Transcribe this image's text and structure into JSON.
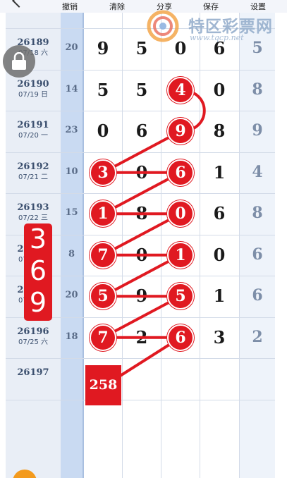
{
  "toolbar": {
    "undo": "撤销",
    "clear": "清除",
    "share": "分享",
    "save": "保存",
    "settings": "设置"
  },
  "watermark": {
    "title": "特区彩票网",
    "url": "www.tqcp.net"
  },
  "rows": [
    {
      "issue": "26189",
      "date": "07/18 六",
      "sum": "20",
      "digits": [
        "9",
        "5",
        "0",
        "6"
      ],
      "right": "5"
    },
    {
      "issue": "26190",
      "date": "07/19 日",
      "sum": "14",
      "digits": [
        "5",
        "5",
        "4",
        "0"
      ],
      "right": "8"
    },
    {
      "issue": "26191",
      "date": "07/20 一",
      "sum": "23",
      "digits": [
        "0",
        "6",
        "9",
        "8"
      ],
      "right": "9"
    },
    {
      "issue": "26192",
      "date": "07/21 二",
      "sum": "10",
      "digits": [
        "3",
        "0",
        "6",
        "1"
      ],
      "right": "4"
    },
    {
      "issue": "26193",
      "date": "07/22 三",
      "sum": "15",
      "digits": [
        "1",
        "8",
        "0",
        "6"
      ],
      "right": "8"
    },
    {
      "issue": "26194",
      "date": "07/23 四",
      "sum": "8",
      "digits": [
        "7",
        "0",
        "1",
        "0"
      ],
      "right": "6"
    },
    {
      "issue": "26195",
      "date": "07/24 五",
      "sum": "20",
      "digits": [
        "5",
        "9",
        "5",
        "1"
      ],
      "right": "6"
    },
    {
      "issue": "26196",
      "date": "07/25 六",
      "sum": "18",
      "digits": [
        "7",
        "2",
        "6",
        "3"
      ],
      "right": "2"
    },
    {
      "issue": "26197",
      "date": "",
      "sum": "",
      "digits": [
        "",
        "",
        "",
        ""
      ],
      "right": ""
    }
  ],
  "balls": [
    {
      "row": 1,
      "col": 2,
      "value": "4"
    },
    {
      "row": 2,
      "col": 2,
      "value": "9"
    },
    {
      "row": 3,
      "col": 0,
      "value": "3"
    },
    {
      "row": 3,
      "col": 2,
      "value": "6"
    },
    {
      "row": 4,
      "col": 0,
      "value": "1"
    },
    {
      "row": 4,
      "col": 2,
      "value": "0"
    },
    {
      "row": 5,
      "col": 0,
      "value": "7"
    },
    {
      "row": 5,
      "col": 2,
      "value": "1"
    },
    {
      "row": 6,
      "col": 0,
      "value": "5"
    },
    {
      "row": 6,
      "col": 2,
      "value": "5"
    },
    {
      "row": 7,
      "col": 0,
      "value": "7"
    },
    {
      "row": 7,
      "col": 2,
      "value": "6"
    }
  ],
  "prediction": "258",
  "badge": [
    "3",
    "6",
    "9"
  ],
  "icons": {
    "lock": "lock-icon",
    "back": "back-icon",
    "logo": "logo-icon",
    "fab": "floating-action-icon"
  },
  "colors": {
    "accent_red": "#e01921",
    "column_blue": "#c9daf2",
    "fab_orange": "#f39a1d"
  }
}
